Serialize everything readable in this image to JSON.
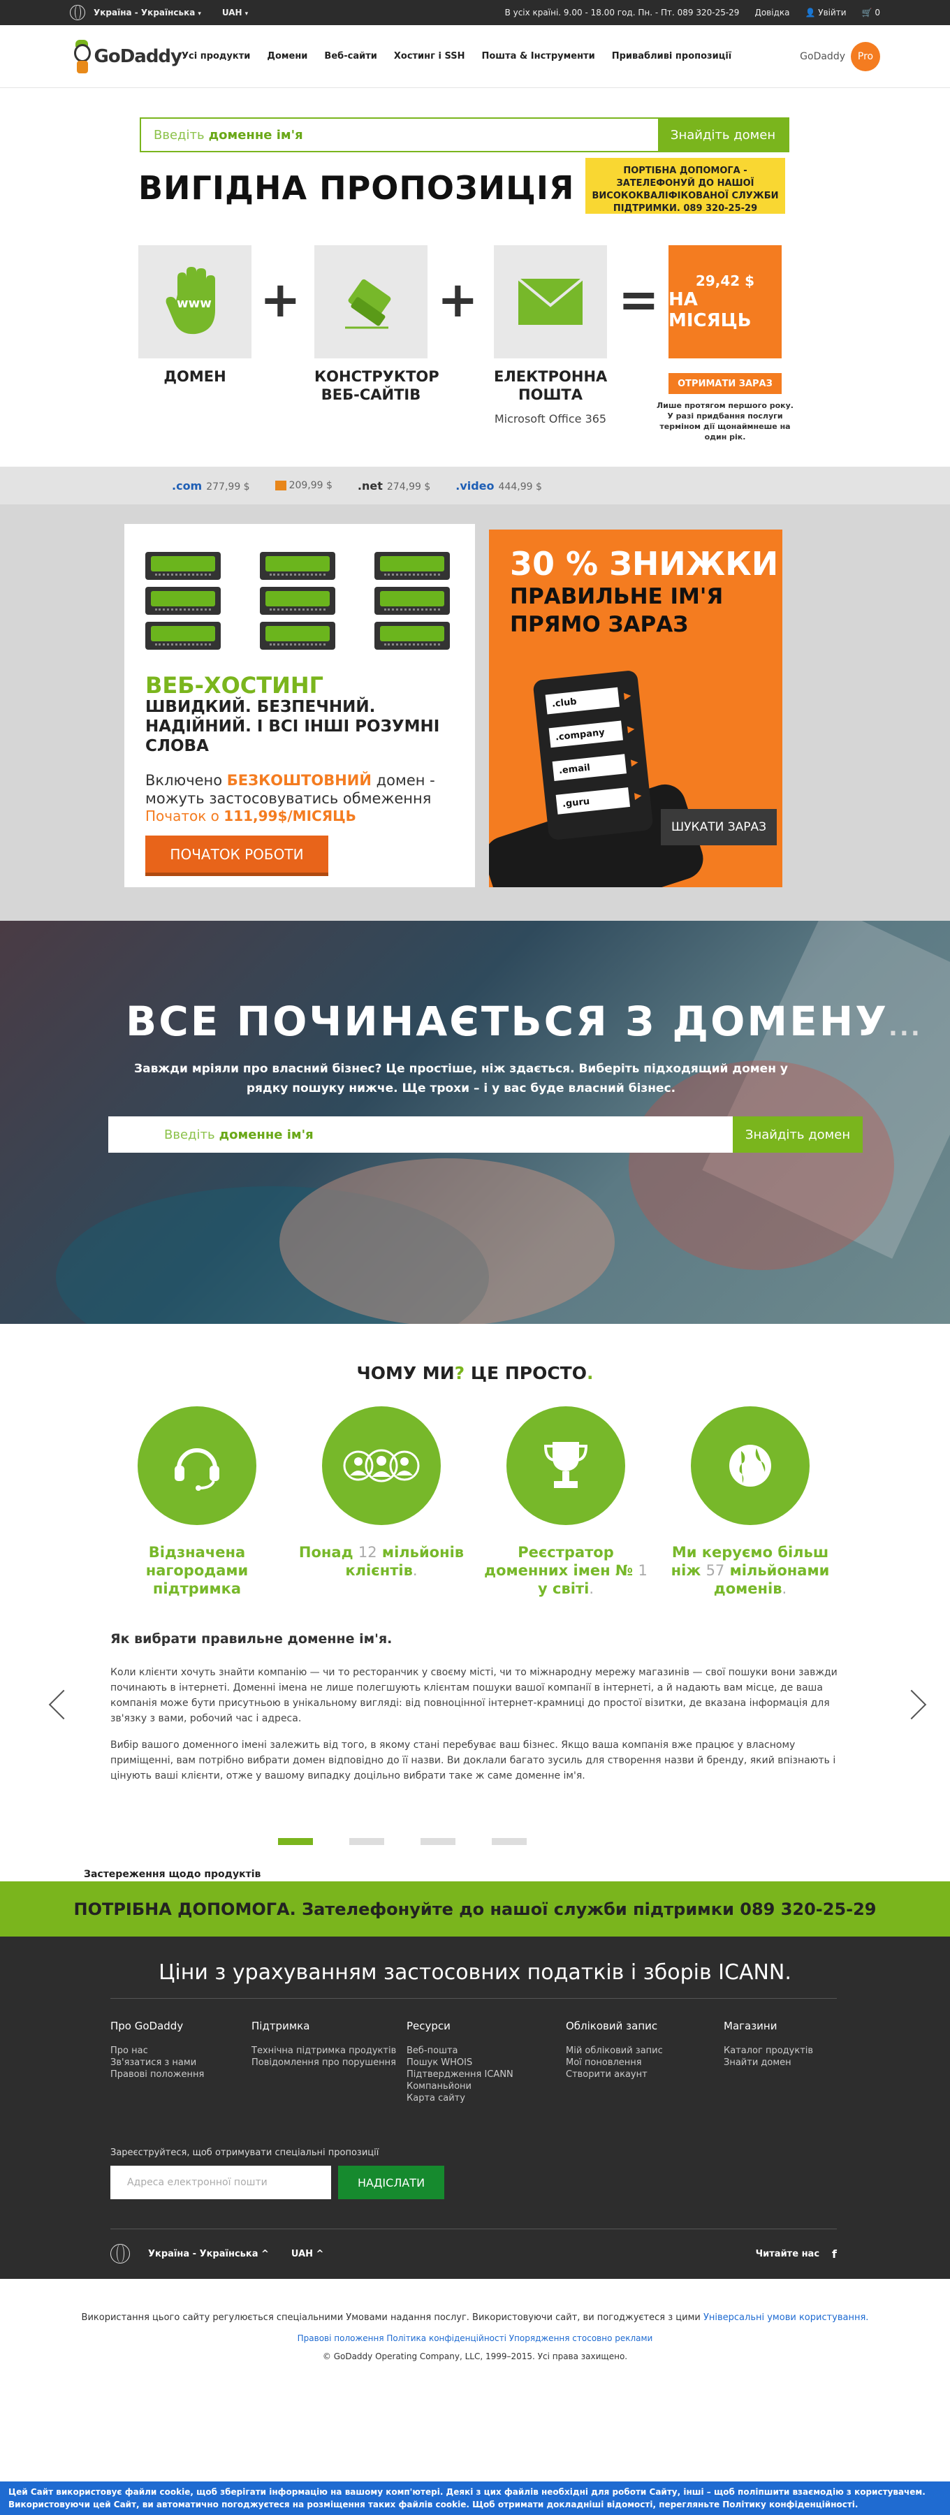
{
  "topbar": {
    "region": "Україна - Українська",
    "currency": "UAH",
    "hours": "В усіх країні. 9.00 - 18.00 год. Пн. - Пт. 089 320-25-29",
    "help": "Довідка",
    "signin": "Увійти",
    "cart_count": "0"
  },
  "header": {
    "logo": "GoDaddy",
    "nav": [
      "Усі продукти",
      "Домени",
      "Веб-сайти",
      "Хостинг і SSH",
      "Пошта & Інструменти",
      "Привабливі пропозиції"
    ],
    "pro_label": "GoDaddy",
    "pro_badge": "Pro"
  },
  "search_top": {
    "placeholder_prefix": "Введіть",
    "placeholder_bold": "доменне ім'я",
    "button": "Знайдіть домен"
  },
  "offer": {
    "title": "ВИГІДНА ПРОПОЗИЦІЯ",
    "support": "ПОРТІБНА ДОПОМОГА - ЗАТЕЛЕФОНУЙ ДО НАШОЇ ВИСОКОКВАЛІФІКОВАНОЇ СЛУЖБИ ПІДТРИМКИ. 089 320-25-29",
    "items": [
      {
        "label": "ДОМЕН",
        "sub": ""
      },
      {
        "label": "КОНСТРУКТОР ВЕБ-САЙТІВ",
        "sub": ""
      },
      {
        "label": "ЕЛЕКТРОННА ПОШТА",
        "sub": "Microsoft Office 365"
      }
    ],
    "plus": "+",
    "equals": "=",
    "price_line1": "29,42 $",
    "price_line2": "НА МІСЯЦЬ",
    "get_now": "ОТРИМАТИ ЗАРАЗ",
    "price_note": "Лише протягом першого року. У разі придбання послуги терміном дії щонаймнеше на один рік."
  },
  "tlds": [
    {
      "name": ".com",
      "price": "277,99 $"
    },
    {
      "name": "",
      "price": "209,99 $"
    },
    {
      "name": ".net",
      "price": "274,99 $"
    },
    {
      "name": ".video",
      "price": "444,99 $"
    }
  ],
  "hosting": {
    "title": "ВЕБ-ХОСТИНГ",
    "tagline": "ШВИДКИЙ. БЕЗПЕЧНИЙ. НАДІЙНИЙ. І ВСІ ІНШІ РОЗУМНІ СЛОВА",
    "included_prefix": "Включено",
    "included_bold": "БЕЗКОШТОВНИЙ",
    "included_suffix": "домен - можуть застосовуватись обмеження",
    "from_prefix": "Початок о",
    "from_price": "111,99$/МІСЯЦЬ",
    "cta": "ПОЧАТОК РОБОТИ"
  },
  "sale": {
    "headline": "30 % ЗНИЖКИ",
    "line": "ПРАВИЛЬНЕ ІМ'Я ПРЯМО ЗАРАЗ",
    "phone_tlds": [
      ".club",
      ".company",
      ".email",
      ".guru"
    ],
    "cta": "ШУКАТИ ЗАРАЗ"
  },
  "hero": {
    "title": "ВСЕ ПОЧИНАЄТЬСЯ З ДОМЕНУ",
    "title_dots": "...",
    "sub": "Завжди мріяли про власний бізнес? Це простіше, ніж здається. Виберіть підходящий домен у рядку пошуку нижче. Ще трохи – і у вас буде власний бізнес.",
    "placeholder_prefix": "Введіть",
    "placeholder_bold": "доменне ім'я",
    "button": "Знайдіть домен"
  },
  "why": {
    "title_a": "ЧОМУ МИ",
    "title_q": "?",
    "title_b": " ЦЕ ПРОСТО",
    "title_end": ".",
    "features": [
      {
        "icon": "headset-icon",
        "a": "Відзначена нагородами підтримка",
        "g": ""
      },
      {
        "icon": "people-icon",
        "a": "Понад ",
        "g": "12",
        "b": " мільйонів клієнтів",
        "end": "."
      },
      {
        "icon": "trophy-icon",
        "a": "Реєстратор доменних імен № ",
        "g": "1",
        "b": " у світі",
        "end": "."
      },
      {
        "icon": "globe-icon",
        "a": "Ми керуємо більш ніж ",
        "g": "57",
        "b": " мільйонами доменів",
        "end": "."
      }
    ],
    "article_title": "Як вибрати правильне доменне ім'я.",
    "p1": "Коли клієнти хочуть знайти компанію — чи то ресторанчик у своєму місті, чи то міжнародну мережу магазинів — свої пошуки вони завжди починають в інтернеті. Доменні імена не лише полегшують клієнтам пошуки вашої компанії в інтернеті, а й надають вам місце, де ваша компанія може бути присутньою в унікальному вигляді: від повноцінної інтернет-крамниці до простої візитки, де вказана інформація для зв'язку з вами, робочий час і адреса.",
    "p2": "Вибір вашого доменного імені залежить від того, в якому стані перебуває ваш бізнес. Якщо ваша компанія вже працює у власному приміщенні, вам потрібно вибрати домен відповідно до її назви. Ви доклали багато зусиль для створення назви й бренду, який впізнають і цінують ваші клієнти, отже у вашому випадку доцільно вибрати такe ж саме доменне ім'я.",
    "disclaimer": "Застереження щодо продуктів"
  },
  "help_band": "ПОТРІБНА ДОПОМОГА. Зателефонуйте до нашої служби підтримки 089 320-25-29",
  "footer": {
    "title": "Ціни з урахуванням застосовних податків і зборів ICANN.",
    "columns": [
      {
        "heading": "Про GoDaddy",
        "links": [
          "Про нас",
          "Зв'язатися з нами",
          "Правові положення"
        ]
      },
      {
        "heading": "Підтримка",
        "links": [
          "Технічна підтримка продуктів",
          "Повідомлення про порушення"
        ]
      },
      {
        "heading": "Ресурси",
        "links": [
          "Веб-пошта",
          "Пошук WHOIS",
          "Підтвердження ICANN",
          "Компаньйони",
          "Карта сайту"
        ]
      },
      {
        "heading": "Обліковий запис",
        "links": [
          "Мій обліковий запис",
          "Мої поновлення",
          "Створити акаунт"
        ]
      },
      {
        "heading": "Магазини",
        "links": [
          "Каталог продуктів",
          "Знайти домен"
        ]
      }
    ],
    "subscribe": "Зареєструйтеся, щоб отримувати спеціальні пропозиції",
    "email_placeholder": "Адреса електронної пошти",
    "send": "НАДІСЛАТИ",
    "region": "Україна - Українська",
    "currency": "UAH",
    "follow": "Читайте нас"
  },
  "legal": {
    "line1": "Використання цього сайту регулюється спеціальними Умовами надання послуг. Використовуючи сайт, ви погоджуєтеся з цими",
    "line1_link": "Універсальні умови користування.",
    "line2": "Правові положення   Політика конфіденційності   Упорядження стосовно реклами",
    "line3": "© GoDaddy Operating Company, LLC, 1999–2015. Усі права захищено."
  },
  "cookie": "Цей Сайт використовує файли cookie, щоб зберігати інформацію на вашому комп'ютері. Деякі з цих файлів необхідні для роботи Сайту, інші – щоб поліпшити взаємодію з користувачем. Використовуючи цей Сайт, ви автоматично погоджуєтеся на розміщення таких файлів cookie. Щоб отримати докладніші відомості, перегляньте Політику конфіденційності."
}
